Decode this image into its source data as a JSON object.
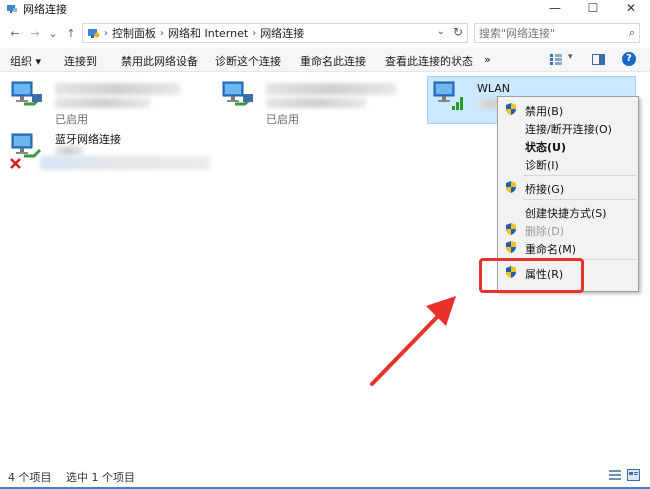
{
  "window": {
    "title": "网络连接",
    "controls": {
      "minimize": "—",
      "maximize": "☐",
      "close": "✕"
    }
  },
  "nav": {
    "back": "←",
    "forward": "→",
    "dropdown": "⌄",
    "up": "↑"
  },
  "address": {
    "crumbs": [
      "控制面板",
      "网络和 Internet",
      "网络连接"
    ],
    "separator": "›"
  },
  "search": {
    "placeholder": "搜索\"网络连接\""
  },
  "toolbar": {
    "organize": "组织 ▾",
    "connect_to": "连接到",
    "disable_device": "禁用此网络设备",
    "diagnose": "诊断这个连接",
    "rename": "重命名此连接",
    "view_status": "查看此连接的状态",
    "more": "»",
    "help": "?"
  },
  "items": [
    {
      "name": "",
      "status": "已启用"
    },
    {
      "name": "",
      "status": "已启用"
    },
    {
      "name": "WLAN",
      "status": ""
    },
    {
      "name": "蓝牙网络连接",
      "status": ""
    }
  ],
  "context_menu": {
    "items": [
      {
        "label": "禁用(B)",
        "shield": true
      },
      {
        "label": "连接/断开连接(O)",
        "shield": false
      },
      {
        "label": "状态(U)",
        "shield": false,
        "bold": true
      },
      {
        "label": "诊断(I)",
        "shield": false
      },
      {
        "label": "桥接(G)",
        "shield": true
      },
      {
        "label": "创建快捷方式(S)",
        "shield": false
      },
      {
        "label": "删除(D)",
        "shield": true,
        "disabled": true
      },
      {
        "label": "重命名(M)",
        "shield": true
      },
      {
        "label": "属性(R)",
        "shield": true
      }
    ]
  },
  "status_bar": {
    "count": "4 个项目",
    "selected": "选中 1 个项目"
  },
  "colors": {
    "accent": "#1769c8",
    "selection": "#cce8ff",
    "highlight": "#e8322b"
  }
}
